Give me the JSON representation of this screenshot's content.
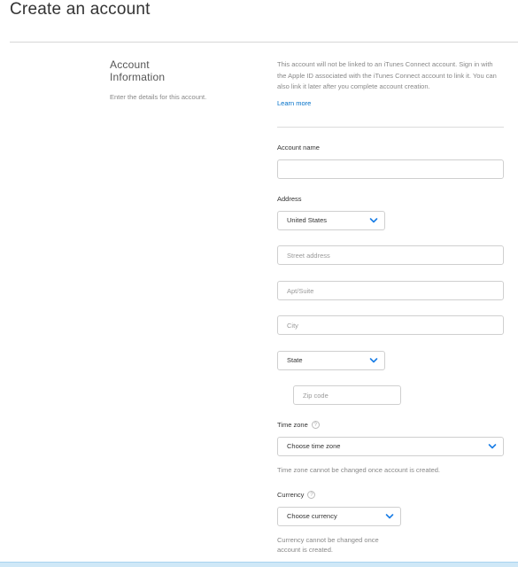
{
  "page": {
    "title": "Create an account"
  },
  "section": {
    "heading_line1": "Account",
    "heading_line2": "Information",
    "description": "Enter the details for this account."
  },
  "info": {
    "text": "This account will not be linked to an iTunes Connect account. Sign in with the Apple ID associated with the iTunes Connect account to link it. You can also link it later after you complete account creation.",
    "learn_more": "Learn more"
  },
  "form": {
    "account_name": {
      "label": "Account name",
      "value": "",
      "placeholder": ""
    },
    "address": {
      "label": "Address",
      "country": "United States",
      "street_placeholder": "Street address",
      "apt_placeholder": "Apt/Suite",
      "city_placeholder": "City",
      "state": "State",
      "zip_placeholder": "Zip code"
    },
    "time_zone": {
      "label": "Time zone",
      "help": "?",
      "selected": "Choose time zone",
      "note": "Time zone cannot be changed once account is created."
    },
    "currency": {
      "label": "Currency",
      "help": "?",
      "selected": "Choose currency",
      "note_line1": "Currency cannot be changed once",
      "note_line2": "account is created."
    }
  },
  "icons": {
    "chevron": "chevron-down-icon",
    "help": "help-circle-icon"
  },
  "colors": {
    "link": "#0070c9",
    "chevron": "#1a7ee6"
  }
}
